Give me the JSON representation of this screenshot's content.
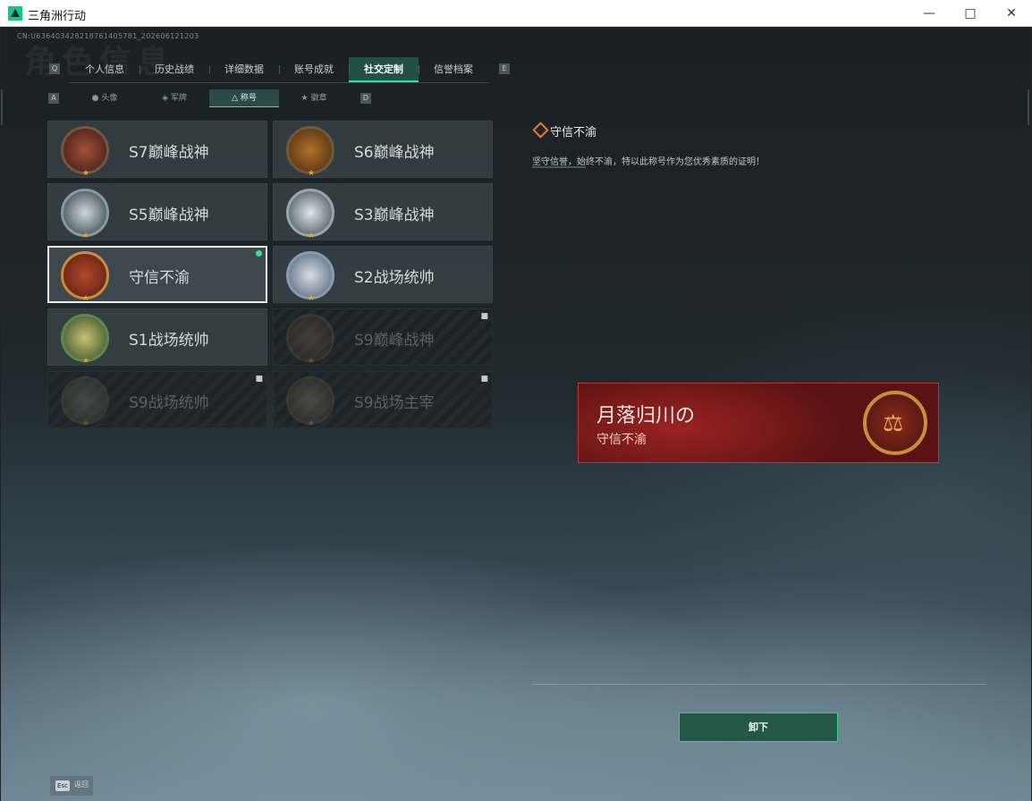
{
  "window": {
    "title": "三角洲行动",
    "minimize_icon": "minimize-icon",
    "maximize_icon": "maximize-icon",
    "close_icon": "close-icon"
  },
  "header": {
    "uid": "CN:U636403428218761405781_202606121203",
    "background_title": "角色信息",
    "prev_key": "Q",
    "next_key": "E"
  },
  "tabs": [
    {
      "label": "个人信息",
      "active": false
    },
    {
      "label": "历史战绩",
      "active": false
    },
    {
      "label": "详细数据",
      "active": false
    },
    {
      "label": "账号成就",
      "active": false
    },
    {
      "label": "社交定制",
      "active": true
    },
    {
      "label": "信誉档案",
      "active": false
    }
  ],
  "subtabs": {
    "prev_key": "A",
    "next_key": "D",
    "items": [
      {
        "label": "头像",
        "icon": "person-icon",
        "active": false
      },
      {
        "label": "军牌",
        "icon": "dogtag-icon",
        "active": false
      },
      {
        "label": "称号",
        "icon": "title-icon",
        "active": true
      },
      {
        "label": "徽章",
        "icon": "emblem-icon",
        "active": false
      }
    ]
  },
  "titles": [
    {
      "name": "S7巅峰战神",
      "locked": false,
      "selected": false,
      "equipped": false,
      "color": "#7a2e24"
    },
    {
      "name": "S6巅峰战神",
      "locked": false,
      "selected": false,
      "equipped": false,
      "color": "#8a4a1c"
    },
    {
      "name": "S5巅峰战神",
      "locked": false,
      "selected": false,
      "equipped": false,
      "color": "#2a3a44"
    },
    {
      "name": "S3巅峰战神",
      "locked": false,
      "selected": false,
      "equipped": false,
      "color": "#3a4650"
    },
    {
      "name": "守信不渝",
      "locked": false,
      "selected": true,
      "equipped": true,
      "color": "#8a2a1d"
    },
    {
      "name": "S2战场统帅",
      "locked": false,
      "selected": false,
      "equipped": false,
      "color": "#4a5e7a"
    },
    {
      "name": "S1战场统帅",
      "locked": false,
      "selected": false,
      "equipped": false,
      "color": "#4f6a3a"
    },
    {
      "name": "S9巅峰战神",
      "locked": true,
      "selected": false,
      "equipped": false,
      "color": "#6a4a3a"
    },
    {
      "name": "S9战场统帅",
      "locked": true,
      "selected": false,
      "equipped": false,
      "color": "#5a5a4a"
    },
    {
      "name": "S9战场主宰",
      "locked": true,
      "selected": false,
      "equipped": false,
      "color": "#6a5a4a"
    }
  ],
  "detail": {
    "title": "守信不渝",
    "description": "坚守信誉，始终不渝，特以此称号作为您优秀素质的证明！"
  },
  "banner": {
    "player_name": "月落归川の",
    "title": "守信不渝"
  },
  "actions": {
    "unequip_label": "卸下"
  },
  "footer": {
    "esc_key": "Esc",
    "back_label": "返回"
  },
  "colors": {
    "accent": "#2ee6a0",
    "equipped_dot": "#38e38d",
    "banner_red": "#8a1f1d",
    "detail_icon": "#e07b3a"
  }
}
